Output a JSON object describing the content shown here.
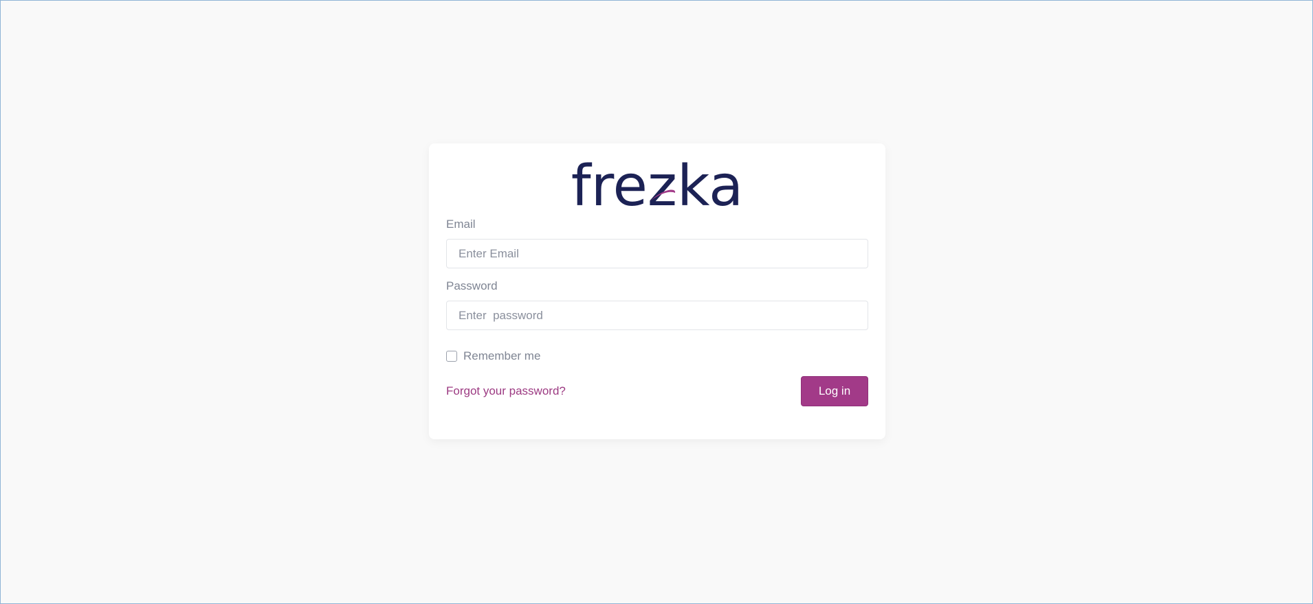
{
  "brand": {
    "logo_text": "frezka",
    "text_color": "#1c2255",
    "swoosh_color": "#a23a88"
  },
  "form": {
    "email": {
      "label": "Email",
      "placeholder": "Enter Email",
      "value": ""
    },
    "password": {
      "label": "Password",
      "placeholder": "Enter  password",
      "value": ""
    },
    "remember": {
      "label": "Remember me",
      "checked": false
    },
    "forgot_link": "Forgot your password?",
    "submit_label": "Log in"
  },
  "colors": {
    "background": "#f9f9f9",
    "card": "#ffffff",
    "accent": "#a23a88",
    "muted_text": "#7f8593"
  }
}
